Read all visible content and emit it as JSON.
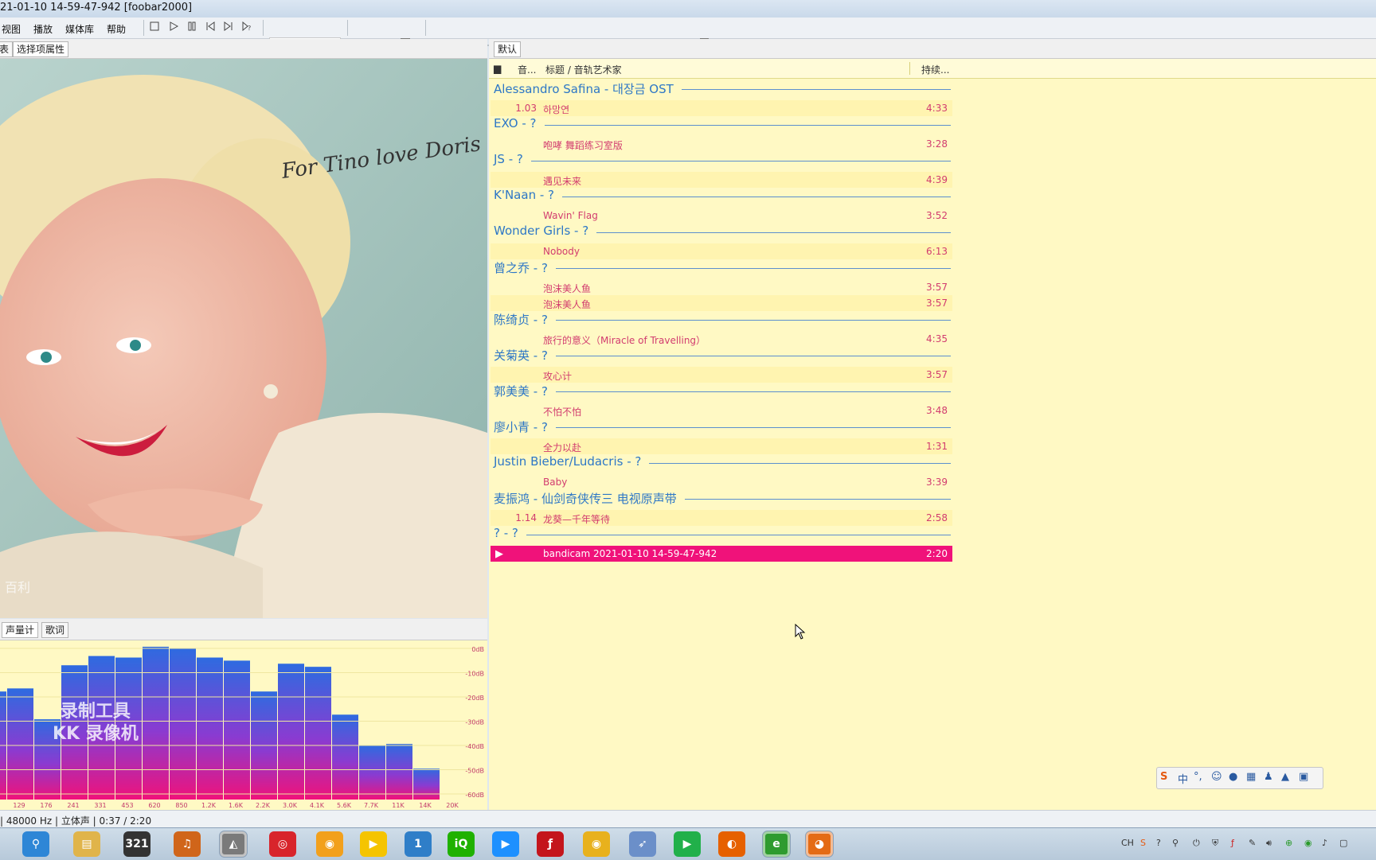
{
  "window": {
    "title": "21-01-10 14-59-47-942  [foobar2000]"
  },
  "menu": {
    "items": [
      "视图",
      "播放",
      "媒体库",
      "帮助"
    ]
  },
  "left_panel": {
    "tabs": [
      "表",
      "选择项属性"
    ],
    "album_art": {
      "autograph": "For Tino love Doris Day",
      "watermark": "百利"
    }
  },
  "vis_panel": {
    "tabs": [
      "声量计",
      "歌词"
    ],
    "watermark_line1": "录制工具",
    "watermark_line2": "KK 录像机",
    "db_labels": [
      "0dB",
      "-10dB",
      "-20dB",
      "-30dB",
      "-40dB",
      "-50dB",
      "-60dB"
    ],
    "freq_labels": [
      "129",
      "176",
      "241",
      "331",
      "453",
      "620",
      "850",
      "1.2K",
      "1.6K",
      "2.2K",
      "3.0K",
      "4.1K",
      "5.6K",
      "7.7K",
      "11K",
      "14K",
      "20K"
    ],
    "levels": [
      0.7,
      0.72,
      0.52,
      0.87,
      0.93,
      0.92,
      0.99,
      0.98,
      0.92,
      0.9,
      0.7,
      0.88,
      0.86,
      0.55,
      0.35,
      0.36,
      0.2,
      0
    ]
  },
  "playlist": {
    "tab": "默认",
    "columns": {
      "number": "音...",
      "title": "标题 / 音轨艺术家",
      "duration": "持续..."
    },
    "groups": [
      {
        "header": "Alessandro Safina - 대장금 OST",
        "tracks": [
          {
            "num": "1.03",
            "title": "하망연",
            "dur": "4:33"
          }
        ]
      },
      {
        "header": "EXO - ?",
        "tracks": [
          {
            "num": "",
            "title": "咆哮 舞蹈练习室版",
            "dur": "3:28"
          }
        ]
      },
      {
        "header": "JS - ?",
        "tracks": [
          {
            "num": "",
            "title": "遇见未来",
            "dur": "4:39"
          }
        ]
      },
      {
        "header": "K'Naan - ?",
        "tracks": [
          {
            "num": "",
            "title": "Wavin' Flag",
            "dur": "3:52"
          }
        ]
      },
      {
        "header": "Wonder Girls - ?",
        "tracks": [
          {
            "num": "",
            "title": "Nobody",
            "dur": "6:13"
          }
        ]
      },
      {
        "header": "曾之乔 - ?",
        "tracks": [
          {
            "num": "",
            "title": "泡沫美人鱼",
            "dur": "3:57"
          },
          {
            "num": "",
            "title": "泡沫美人鱼",
            "dur": "3:57"
          }
        ]
      },
      {
        "header": "陈绮贞 - ?",
        "tracks": [
          {
            "num": "",
            "title": "旅行的意义（Miracle of Travelling）",
            "dur": "4:35"
          }
        ]
      },
      {
        "header": "关菊英 - ?",
        "tracks": [
          {
            "num": "",
            "title": "攻心计",
            "dur": "3:57"
          }
        ]
      },
      {
        "header": "郭美美 - ?",
        "tracks": [
          {
            "num": "",
            "title": "不怕不怕",
            "dur": "3:48"
          }
        ]
      },
      {
        "header": "廖小青 - ?",
        "tracks": [
          {
            "num": "",
            "title": "全力以赴",
            "dur": "1:31"
          }
        ]
      },
      {
        "header": "Justin Bieber/Ludacris - ?",
        "tracks": [
          {
            "num": "",
            "title": "Baby",
            "dur": "3:39"
          }
        ]
      },
      {
        "header": "麦振鸿 - 仙剑奇侠传三 电视原声带",
        "tracks": [
          {
            "num": "1.14",
            "title": "龙葵—千年等待",
            "dur": "2:58"
          }
        ]
      },
      {
        "header": "? - ?",
        "tracks": [
          {
            "num": "",
            "title": "bandicam 2021-01-10 14-59-47-942",
            "dur": "2:20",
            "playing": true
          }
        ]
      }
    ]
  },
  "statusbar": {
    "text": "| 48000 Hz | 立体声 | 0:37 / 2:20"
  },
  "taskbar": {
    "apps": [
      "search",
      "file-explorer",
      "321-player",
      "headphones",
      "alien",
      "netease-music",
      "media-player",
      "potplayer",
      "one",
      "iqiyi",
      "youku",
      "flash",
      "chrome",
      "bird",
      "play",
      "firefox",
      "ie",
      "capture"
    ],
    "tray": {
      "lang": "CH"
    }
  },
  "ime": {
    "mode": "中"
  },
  "colors": {
    "accent": "#f0127a",
    "group_text": "#2d77c6",
    "track_text": "#d23c6f",
    "playlist_bg": "#fff9c4"
  }
}
